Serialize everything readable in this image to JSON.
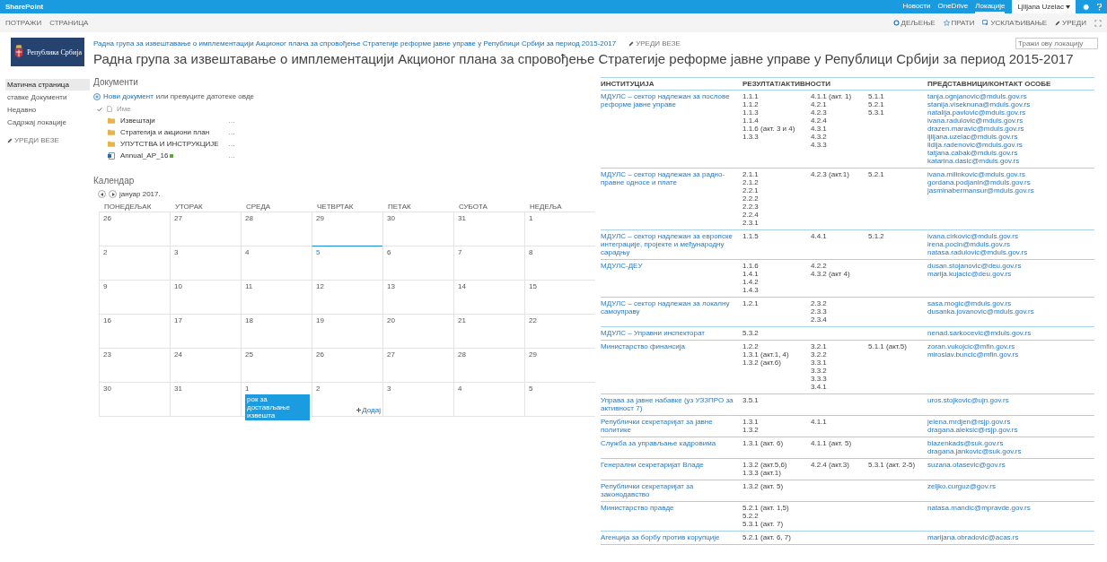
{
  "suite_bar": {
    "brand": "SharePoint",
    "links": [
      {
        "label": "Новости",
        "selected": false
      },
      {
        "label": "OneDrive",
        "selected": false
      },
      {
        "label": "Локације",
        "selected": true
      }
    ],
    "user": "Ljiljana Uzelac"
  },
  "ribbon": {
    "tabs": [
      "ПОТРАЖИ",
      "СТРАНИЦА"
    ],
    "actions": [
      {
        "kind": "share",
        "label": "ДЕЉЕЊЕ"
      },
      {
        "kind": "follow",
        "label": "ПРАТИ"
      },
      {
        "kind": "sync",
        "label": "УСКЛАЂИВАЊЕ"
      },
      {
        "kind": "edit",
        "label": "УРЕДИ"
      }
    ]
  },
  "header": {
    "logo_text": "Република Србија",
    "breadcrumb": "Радна група за извештавање о имплементацији Акционог плана за спровођење Стратегије реформе јавне управе у Републици Србији за период 2015-2017",
    "edit_links": "УРЕДИ ВЕЗЕ",
    "title": "Радна група за извештавање о имплементацији Акционог плана за спровођење Стратегије реформе јавне управе у Републици Србији за период 2015-2017",
    "search": {
      "placeholder": "Тражи ову локацију"
    }
  },
  "nav": {
    "items": [
      {
        "label": "Матична страница",
        "selected": true
      },
      {
        "label": "ставке Документи",
        "selected": false
      },
      {
        "label": "Недавно",
        "selected": false
      },
      {
        "label": "Садржај локације",
        "selected": false
      }
    ],
    "edit_links": "УРЕДИ ВЕЗЕ"
  },
  "documents": {
    "title": "Документи",
    "new_link": "Нови документ",
    "new_hint": "или превуците датотеке овде",
    "name_header": "Име",
    "items": [
      {
        "kind": "folder",
        "name": "Извештаји",
        "menu": "…",
        "new": false
      },
      {
        "kind": "folder",
        "name": "Стратегија и акциони план",
        "menu": "…",
        "new": false
      },
      {
        "kind": "folder",
        "name": "УПУТСТВА И ИНСТРУКЦИЈЕ",
        "menu": "…",
        "new": false
      },
      {
        "kind": "file",
        "name": "Annual_AP_16",
        "menu": "…",
        "new": true
      }
    ]
  },
  "calendar": {
    "title": "Календар",
    "month": "јануар 2017.",
    "weekdays": [
      "ПОНЕДЕЉАК",
      "УТОРАК",
      "СРЕДА",
      "ЧЕТВРТАК",
      "ПЕТАК",
      "СУБОТА",
      "НЕДЕЉА"
    ],
    "weeks": [
      [
        {
          "day": "26",
          "today": false
        },
        {
          "day": "27",
          "today": false
        },
        {
          "day": "28",
          "today": false
        },
        {
          "day": "29",
          "today": false
        },
        {
          "day": "30",
          "today": false
        },
        {
          "day": "31",
          "today": false
        },
        {
          "day": "1",
          "today": false
        }
      ],
      [
        {
          "day": "2",
          "today": false
        },
        {
          "day": "3",
          "today": false
        },
        {
          "day": "4",
          "today": false
        },
        {
          "day": "5",
          "today": true
        },
        {
          "day": "6",
          "today": false
        },
        {
          "day": "7",
          "today": false
        },
        {
          "day": "8",
          "today": false
        }
      ],
      [
        {
          "day": "9",
          "today": false
        },
        {
          "day": "10",
          "today": false
        },
        {
          "day": "11",
          "today": false
        },
        {
          "day": "12",
          "today": false
        },
        {
          "day": "13",
          "today": false
        },
        {
          "day": "14",
          "today": false
        },
        {
          "day": "15",
          "today": false
        }
      ],
      [
        {
          "day": "16",
          "today": false
        },
        {
          "day": "17",
          "today": false
        },
        {
          "day": "18",
          "today": false
        },
        {
          "day": "19",
          "today": false
        },
        {
          "day": "20",
          "today": false
        },
        {
          "day": "21",
          "today": false
        },
        {
          "day": "22",
          "today": false
        }
      ],
      [
        {
          "day": "23",
          "today": false
        },
        {
          "day": "24",
          "today": false
        },
        {
          "day": "25",
          "today": false
        },
        {
          "day": "26",
          "today": false
        },
        {
          "day": "27",
          "today": false
        },
        {
          "day": "28",
          "today": false
        },
        {
          "day": "29",
          "today": false
        }
      ],
      [
        {
          "day": "30",
          "today": false
        },
        {
          "day": "31",
          "today": false
        },
        {
          "day": "1",
          "today": false,
          "events": [
            "рок за достављање извешта"
          ]
        },
        {
          "day": "2",
          "today": false,
          "add_label": "Додај"
        },
        {
          "day": "3",
          "today": false
        },
        {
          "day": "4",
          "today": false
        },
        {
          "day": "5",
          "today": false
        }
      ]
    ]
  },
  "table": {
    "columns": [
      "ИНСТИТУЦИЈА",
      "РЕЗУЛТАТ/АКТИВНОСТИ",
      "ПРЕДСТАВНИЦИ/КОНТАКТ ОСОБЕ"
    ],
    "rows": [
      {
        "institution": "МДУЛС – сектор надлежан за послове реформе јавне управе",
        "results_1": [
          "1.1.1",
          "1.1.2",
          "1.1.3",
          "1.1.4",
          "1.1.6 (акт. 3 и 4)",
          "1.3.3"
        ],
        "results_2": [
          "4.1.1 (акт. 1)",
          "4.2.1",
          "4.2.3",
          "4.2.4",
          "4.3.1",
          "4.3.2",
          "4.3.3"
        ],
        "results_3": [
          "5.1.1",
          "5.2.1",
          "5.3.1"
        ],
        "contacts": [
          "tanja.ognjanovic@mduls.gov.rs",
          "stanija.viseknuna@mduls.gov.rs",
          "natalija.pavlovic@mduls.gov.rs",
          "ivana.radulovic@mduls.gov.rs",
          "drazen.maravic@mduls.gov.rs",
          "ljiljana.uzelac@mduls.gov.rs",
          "lidija.radenovic@mduls.gov.rs",
          "tatjana.cabak@mduls.gov.rs",
          "katarina.dasic@mduls.gov.rs"
        ]
      },
      {
        "institution": "МДУЛС – сектор надлежан за радно-правне односе и плате",
        "results_1": [
          "2.1.1",
          "2.1.2",
          "2.2.1",
          "2.2.2",
          "2.2.3",
          "2.2.4",
          "2.3.1"
        ],
        "results_2": [
          "4.2.3 (акт.1)"
        ],
        "results_3": [
          "5.2.1"
        ],
        "contacts": [
          "ivana.milinkovic@mduls.gov.rs",
          "gordana.podjanin@mduls.gov.rs",
          "jasminabermansur@mduls.gov.rs"
        ]
      },
      {
        "institution": "МДУЛС – сектор надлежан за европске интеграције, пројекте и међународну сарадњу",
        "results_1": [
          "1.1.5"
        ],
        "results_2": [
          "4.4.1"
        ],
        "results_3": [
          "5.1.2"
        ],
        "contacts": [
          "ivana.cirkovic@mduls.gov.rs",
          "irena.pocin@mduls.gov.rs",
          "natasa.radulovic@mduls.gov.rs"
        ]
      },
      {
        "institution": "МДУЛС-ДЕУ",
        "results_1": [
          "1.1.6",
          "1.4.1",
          "1.4.2",
          "1.4.3"
        ],
        "results_2": [
          "4.2.2",
          "4.3.2 (акт 4)"
        ],
        "results_3": [],
        "contacts": [
          "dusan.stojanovic@deu.gov.rs",
          "marija.kujacic@deu.gov.rs"
        ]
      },
      {
        "institution": "МДУЛС – сектор надлежан за локалну самоуправу",
        "results_1": [
          "1.2.1"
        ],
        "results_2": [
          "2.3.2",
          "2.3.3",
          "2.3.4"
        ],
        "results_3": [],
        "contacts": [
          "sasa.mogic@mduls.gov.rs",
          "dusanka.jovanovic@mduls.gov.rs"
        ]
      },
      {
        "institution": "МДУЛС – Управни инспекторат",
        "results_1": [
          "5.3.2"
        ],
        "results_2": [],
        "results_3": [],
        "contacts": [
          "nenad.sarkocevic@mduls.gov.rs"
        ]
      },
      {
        "institution": "Министарство финансија",
        "results_1": [
          "1.2.2",
          "1.3.1 (акт.1, 4)",
          "1.3.2 (акт.6)"
        ],
        "results_2": [
          "3.2.1",
          "3.2.2",
          "3.3.1",
          "3.3.2",
          "3.3.3",
          "3.4.1"
        ],
        "results_3": [
          "5.1.1 (акт.5)"
        ],
        "contacts": [
          "zoran.vukojcic@mfin.gov.rs",
          "miroslav.buncic@mfin.gov.rs"
        ]
      },
      {
        "institution": "Управа за јавне набавке (уз УЗЗПРО за активност 7)",
        "results_1": [
          "3.5.1"
        ],
        "results_2": [],
        "results_3": [],
        "contacts": [
          "uros.stojkovic@ujn.gov.rs"
        ]
      },
      {
        "institution": "Републички секретаријат за јавне политике",
        "results_1": [
          "1.3.1",
          "1.3.2"
        ],
        "results_2": [
          "4.1.1"
        ],
        "results_3": [],
        "contacts": [
          "jelena.mrdjen@rsjp.gov.rs",
          "dragana.aleksic@rsjp.gov.rs"
        ]
      },
      {
        "institution": "Служба за управљање кадровима",
        "results_1": [
          "1.3.1 (акт. 6)"
        ],
        "results_2": [
          "4.1.1 (акт. 5)"
        ],
        "results_3": [],
        "contacts": [
          "blazenkads@suk.gov.rs",
          "dragana.jankovic@suk.gov.rs"
        ]
      },
      {
        "institution": "Генерални секретаријат Владе",
        "results_1": [
          "1.3.2 (акт.5,6)",
          "1.3.3 (акт.1)"
        ],
        "results_2": [
          "4.2.4 (акт.3)"
        ],
        "results_3": [
          "5.3.1 (акт. 2-5)"
        ],
        "contacts": [
          "suzana.otasevic@gov.rs"
        ]
      },
      {
        "institution": "Републички секретаријат за законодавство",
        "results_1": [
          "1.3.2 (акт. 5)"
        ],
        "results_2": [],
        "results_3": [],
        "contacts": [
          "zeljko.curguz@gov.rs"
        ]
      },
      {
        "institution": "Министарство правде",
        "results_1": [
          "5.2.1 (акт. 1,5)",
          "5.2.2",
          "5.3.1 (акт. 7)"
        ],
        "results_2": [],
        "results_3": [],
        "contacts": [
          "natasa.mandic@mpravde.gov.rs"
        ]
      },
      {
        "institution": "Агенција за борбу против корупције",
        "results_1": [
          "5.2.1 (акт. 6, 7)"
        ],
        "results_2": [],
        "results_3": [],
        "contacts": [
          "marijana.obradovic@acas.rs"
        ]
      }
    ]
  }
}
